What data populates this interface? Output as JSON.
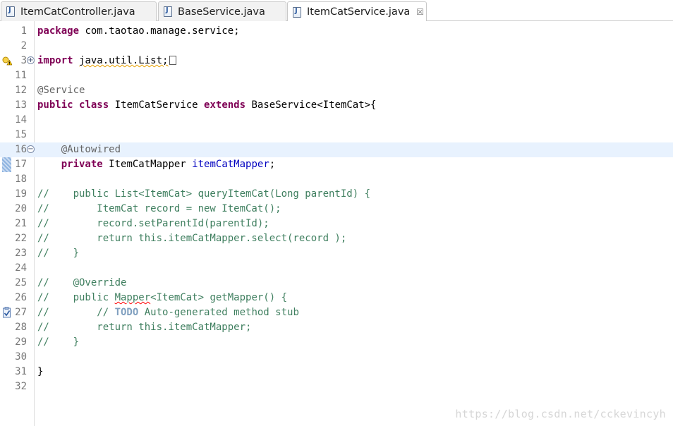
{
  "tabs": [
    {
      "label": "ItemCatController.java",
      "active": false
    },
    {
      "label": "BaseService.java",
      "active": false
    },
    {
      "label": "ItemCatService.java",
      "active": true,
      "close_glyph": "☒"
    }
  ],
  "editor": {
    "lines": [
      {
        "num": "1",
        "tokens": [
          {
            "t": "package",
            "c": "kw"
          },
          {
            "t": " com.taotao.manage.service;"
          }
        ]
      },
      {
        "num": "2",
        "tokens": []
      },
      {
        "num": "3",
        "tokens": [
          {
            "t": "import",
            "c": "kw"
          },
          {
            "t": " "
          },
          {
            "t": "java.util.List;",
            "c": "squiggle"
          }
        ],
        "folded": true,
        "marker": "warning"
      },
      {
        "num": "11",
        "tokens": []
      },
      {
        "num": "12",
        "tokens": [
          {
            "t": "@Service",
            "c": "ann"
          }
        ]
      },
      {
        "num": "13",
        "tokens": [
          {
            "t": "public",
            "c": "kw"
          },
          {
            "t": " "
          },
          {
            "t": "class",
            "c": "kw"
          },
          {
            "t": " ItemCatService "
          },
          {
            "t": "extends",
            "c": "kw"
          },
          {
            "t": " BaseService<ItemCat>{"
          }
        ]
      },
      {
        "num": "14",
        "tokens": []
      },
      {
        "num": "15",
        "tokens": []
      },
      {
        "num": "16",
        "tokens": [
          {
            "t": "    "
          },
          {
            "t": "@Autowired",
            "c": "ann"
          }
        ],
        "current": true,
        "fold": "minus"
      },
      {
        "num": "17",
        "tokens": [
          {
            "t": "    "
          },
          {
            "t": "private",
            "c": "kw"
          },
          {
            "t": " ItemCatMapper "
          },
          {
            "t": "itemCatMapper",
            "c": "fld"
          },
          {
            "t": ";"
          }
        ]
      },
      {
        "num": "18",
        "tokens": []
      },
      {
        "num": "19",
        "tokens": [
          {
            "t": "//    public List<ItemCat> queryItemCat(Long parentId) {",
            "c": "cm"
          }
        ]
      },
      {
        "num": "20",
        "tokens": [
          {
            "t": "//        ItemCat record = new ItemCat();",
            "c": "cm"
          }
        ]
      },
      {
        "num": "21",
        "tokens": [
          {
            "t": "//        record.setParentId(parentId);",
            "c": "cm"
          }
        ]
      },
      {
        "num": "22",
        "tokens": [
          {
            "t": "//        return this.itemCatMapper.select(record );",
            "c": "cm"
          }
        ]
      },
      {
        "num": "23",
        "tokens": [
          {
            "t": "//    }",
            "c": "cm"
          }
        ]
      },
      {
        "num": "24",
        "tokens": []
      },
      {
        "num": "25",
        "tokens": [
          {
            "t": "//    @Override",
            "c": "cm"
          }
        ]
      },
      {
        "num": "26",
        "tokens": [
          {
            "t": "//    public ",
            "c": "cm"
          },
          {
            "t": "Mapper",
            "c": "cm squiggle-red"
          },
          {
            "t": "<ItemCat> getMapper() {",
            "c": "cm"
          }
        ]
      },
      {
        "num": "27",
        "tokens": [
          {
            "t": "//        // ",
            "c": "cm"
          },
          {
            "t": "TODO",
            "c": "todo"
          },
          {
            "t": " Auto-generated method stub",
            "c": "cm"
          }
        ],
        "marker": "task"
      },
      {
        "num": "28",
        "tokens": [
          {
            "t": "//        return this.itemCatMapper;",
            "c": "cm"
          }
        ]
      },
      {
        "num": "29",
        "tokens": [
          {
            "t": "//    }",
            "c": "cm"
          }
        ]
      },
      {
        "num": "30",
        "tokens": []
      },
      {
        "num": "31",
        "tokens": [
          {
            "t": "}"
          }
        ]
      },
      {
        "num": "32",
        "tokens": []
      }
    ]
  },
  "watermark": "https://blog.csdn.net/cckevincyh",
  "colors": {
    "keyword": "#7f0055",
    "annotation": "#646464",
    "comment": "#3f7f5f",
    "field": "#0000c0",
    "current_line": "#e8f2fe"
  },
  "icons": {
    "tab": "java-file-icon",
    "close": "close-icon",
    "warning": "warning-icon",
    "task": "task-icon",
    "fold_expand": "fold-expand-icon",
    "fold_collapse": "fold-collapse-icon"
  }
}
